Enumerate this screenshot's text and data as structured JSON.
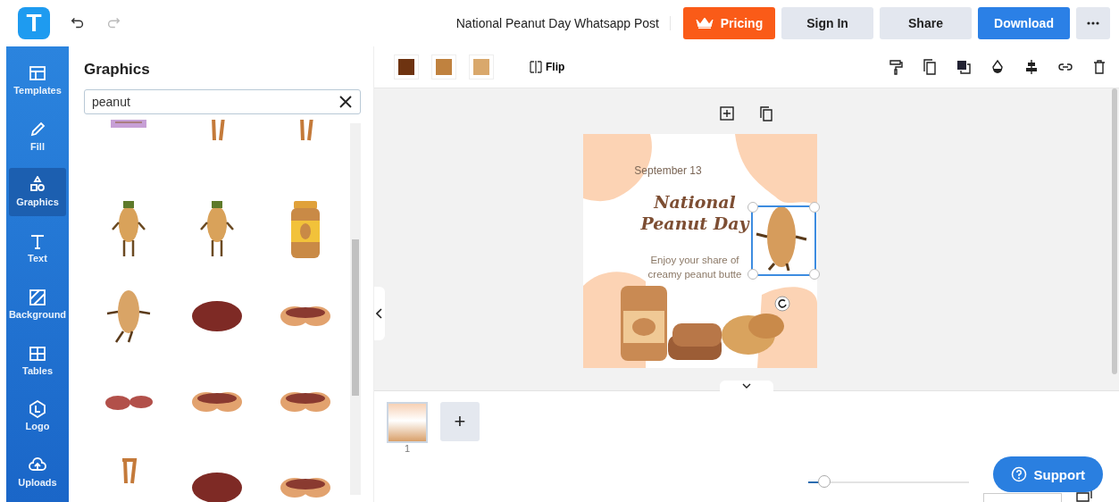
{
  "header": {
    "logo": "T",
    "document_title": "National Peanut Day Whatsapp Post",
    "buttons": [
      {
        "label": "Pricing",
        "kind": "pricing"
      },
      {
        "label": "Sign In",
        "kind": "plain"
      },
      {
        "label": "Share",
        "kind": "plain"
      },
      {
        "label": "Download",
        "kind": "primary"
      }
    ]
  },
  "sidebar": {
    "items": [
      {
        "label": "Templates",
        "selected": false
      },
      {
        "label": "Fill",
        "selected": false
      },
      {
        "label": "Graphics",
        "selected": true
      },
      {
        "label": "Text",
        "selected": false
      },
      {
        "label": "Background",
        "selected": false
      },
      {
        "label": "Tables",
        "selected": false
      },
      {
        "label": "Logo",
        "selected": false
      },
      {
        "label": "Uploads",
        "selected": false
      }
    ]
  },
  "panel": {
    "title": "Graphics",
    "search": {
      "value": "peanut"
    },
    "results": [
      {
        "kind": "banner"
      },
      {
        "kind": "legs"
      },
      {
        "kind": "legs"
      },
      {
        "kind": "figure"
      },
      {
        "kind": "figure"
      },
      {
        "kind": "jar"
      },
      {
        "kind": "sitting"
      },
      {
        "kind": "kernel"
      },
      {
        "kind": "shell"
      },
      {
        "kind": "kernels"
      },
      {
        "kind": "shell"
      },
      {
        "kind": "shell"
      },
      {
        "kind": "legs"
      },
      {
        "kind": "kernel"
      },
      {
        "kind": "shell"
      }
    ]
  },
  "toolbar": {
    "swatches": [
      {
        "color": "#6e3310"
      },
      {
        "color": "#c0823f"
      },
      {
        "color": "#d9a86c"
      }
    ],
    "flip_label": "Flip"
  },
  "design": {
    "date": "September 13",
    "heading_lines": [
      "National",
      "Peanut Day"
    ],
    "body_lines": [
      "Enjoy your share of",
      "creamy peanut butte"
    ]
  },
  "pages": [
    {
      "number": "1",
      "selected": true
    }
  ],
  "add_page": "+",
  "zoom": {
    "level": 0.1
  },
  "support": "Support"
}
